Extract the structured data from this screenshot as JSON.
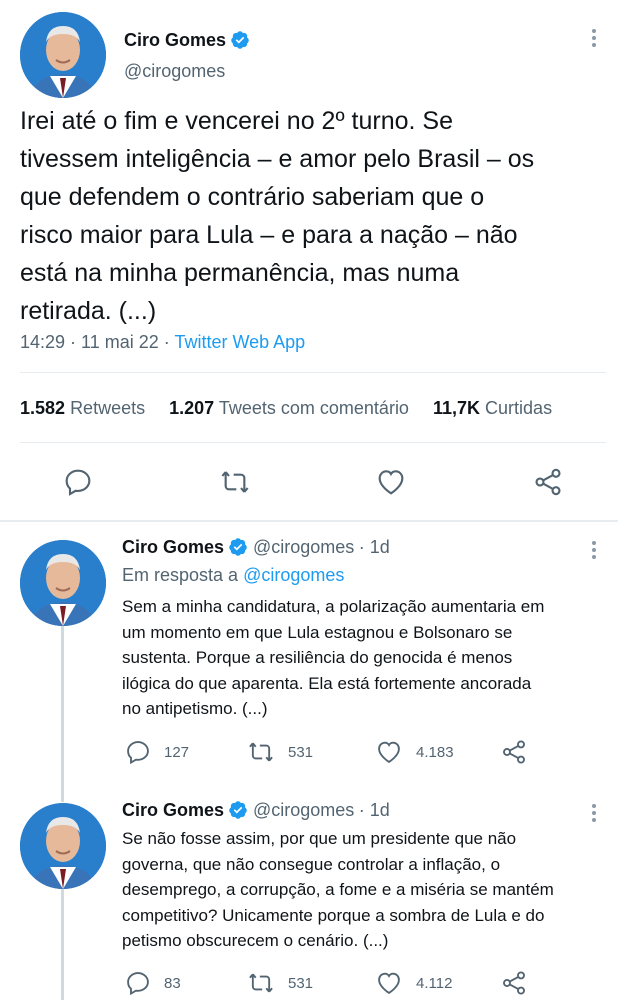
{
  "main_tweet": {
    "author_name": "Ciro Gomes",
    "author_handle": "@cirogomes",
    "text_lines": [
      "Irei até o fim e vencerei no 2º turno. Se",
      "tivessem inteligência – e amor pelo Brasil – os",
      "que defendem o contrário saberiam que o",
      "risco maior para Lula – e para a nação – não",
      "está na minha permanência, mas numa",
      "retirada. (...)"
    ],
    "time": "14:29 · 11 mai 22 · ",
    "source": "Twitter Web App",
    "stats": {
      "retweets_num": "1.582",
      "retweets_label": "Retweets",
      "quotes_num": "1.207",
      "quotes_label": "Tweets com comentário",
      "likes_num": "11,7K",
      "likes_label": "Curtidas"
    }
  },
  "replies": [
    {
      "author_name": "Ciro Gomes",
      "author_handle": "@cirogomes",
      "age": "· 1d",
      "reply_to_prefix": "Em resposta a ",
      "reply_to_handle": "@cirogomes",
      "text_lines": [
        "Sem a minha candidatura, a polarização aumentaria em",
        "um momento em que Lula estagnou e Bolsonaro se",
        "sustenta. Porque a resiliência do genocida é menos",
        "ilógica do que aparenta. Ela está fortemente ancorada",
        "no antipetismo. (...)"
      ],
      "replies_count": "127",
      "retweets_count": "531",
      "likes_count": "4.183"
    },
    {
      "author_name": "Ciro Gomes",
      "author_handle": "@cirogomes",
      "age": "· 1d",
      "text_lines": [
        "Se não fosse assim, por que um presidente que não",
        "governa, que não consegue controlar a inflação, o",
        "desemprego, a corrupção, a fome e a miséria se mantém",
        "competitivo? Unicamente porque a sombra de Lula e do",
        "petismo obscurecem o cenário. (...)"
      ],
      "replies_count": "83",
      "retweets_count": "531",
      "likes_count": "4.112"
    }
  ],
  "colors": {
    "accent": "#1d9bf0",
    "text": "#0f1419",
    "muted": "#536471"
  }
}
